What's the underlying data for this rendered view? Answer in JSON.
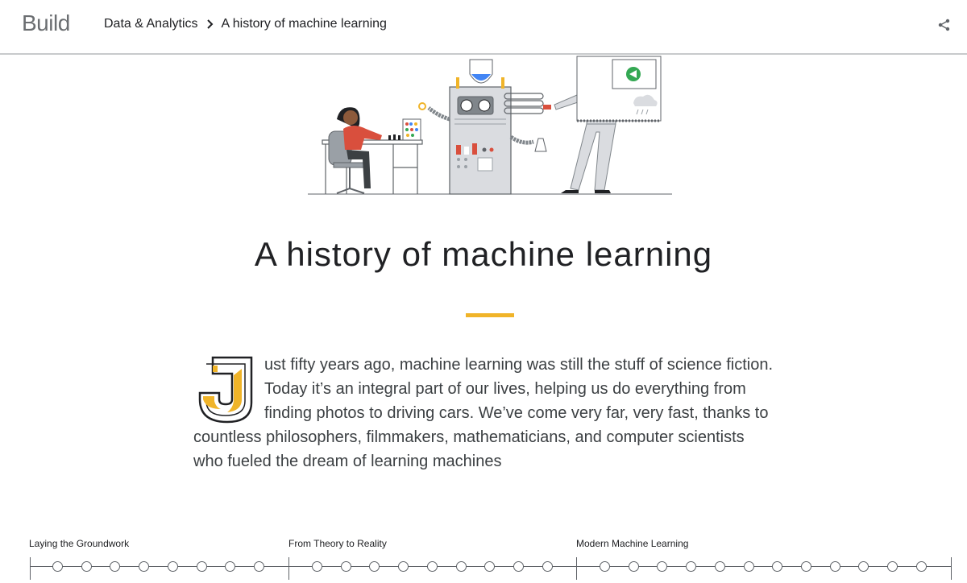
{
  "header": {
    "logo": "Build",
    "breadcrumb": [
      "Data & Analytics",
      "A history of machine learning"
    ],
    "share_icon": "share-icon"
  },
  "article": {
    "title": "A history of machine learning",
    "dropcap_letter": "J",
    "intro": "ust fifty years ago, machine learning was still the stuff of science fiction. Today it’s an integral part of our lives, helping us do everything from finding photos to driving cars. We’ve come very far, very fast, thanks to countless philosophers, filmmakers, mathematicians, and computer scientists who fueled the dream of learning machines"
  },
  "timeline": {
    "eras": [
      {
        "label": "Laying the Groundwork",
        "dot_count": 8
      },
      {
        "label": "From Theory to Reality",
        "dot_count": 9
      },
      {
        "label": "Modern Machine Learning",
        "dot_count": 12
      }
    ]
  },
  "colors": {
    "accent": "#f0b429",
    "text": "#3c4043",
    "heading": "#202124"
  }
}
